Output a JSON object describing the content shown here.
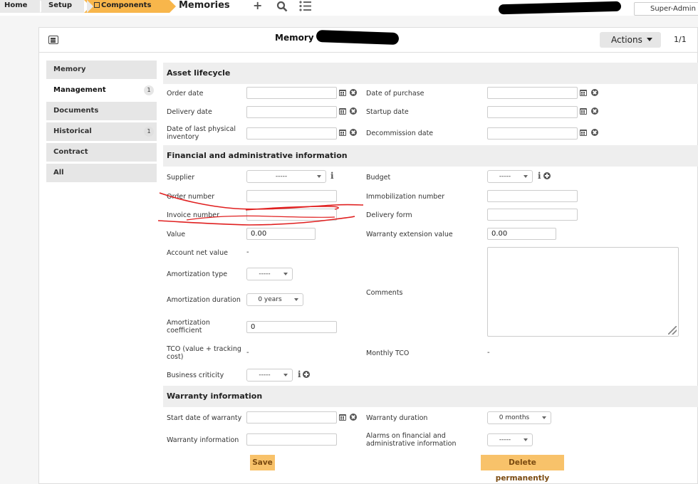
{
  "breadcrumbs": [
    "Home",
    "Setup",
    "Components"
  ],
  "page_heading": "Memories",
  "profile": "Super-Admin",
  "panel": {
    "title": "Memory",
    "actions_label": "Actions",
    "pager": "1/1"
  },
  "tabs": [
    {
      "label": "Memory",
      "count": ""
    },
    {
      "label": "Management",
      "count": "1"
    },
    {
      "label": "Documents",
      "count": ""
    },
    {
      "label": "Historical",
      "count": "1"
    },
    {
      "label": "Contract",
      "count": ""
    },
    {
      "label": "All",
      "count": ""
    }
  ],
  "sections": {
    "lifecycle": "Asset lifecycle",
    "financial": "Financial and administrative information",
    "warranty": "Warranty information"
  },
  "fields": {
    "order_date": "Order date",
    "date_of_purchase": "Date of purchase",
    "delivery_date": "Delivery date",
    "startup_date": "Startup date",
    "last_inventory": "Date of last physical inventory",
    "decommission_date": "Decommission date",
    "supplier": "Supplier",
    "budget": "Budget",
    "order_number": "Order number",
    "immobilization_number": "Immobilization number",
    "invoice_number": "Invoice number",
    "delivery_form": "Delivery form",
    "value": "Value",
    "warranty_ext_value": "Warranty extension value",
    "account_net_value": "Account net value",
    "amortization_type": "Amortization type",
    "amortization_duration": "Amortization duration",
    "comments": "Comments",
    "amortization_coefficient": "Amortization coefficient",
    "tco": "TCO (value + tracking cost)",
    "monthly_tco": "Monthly TCO",
    "business_criticity": "Business criticity",
    "start_warranty": "Start date of warranty",
    "warranty_duration": "Warranty duration",
    "warranty_info": "Warranty information",
    "alarms": "Alarms on financial and administrative information"
  },
  "values": {
    "supplier": "-----",
    "budget": "-----",
    "value": "0.00",
    "warranty_ext_value": "0.00",
    "account_net_value": "-",
    "amortization_type": "-----",
    "amortization_duration": "0 years",
    "amortization_coefficient": "0",
    "tco": "-",
    "monthly_tco": "-",
    "business_criticity": "-----",
    "warranty_duration": "0 months",
    "alarms": "-----"
  },
  "buttons": {
    "save": "Save",
    "delete": "Delete permanently"
  },
  "colors": {
    "accent": "#f8b64b",
    "button": "#f8c26a",
    "annotation": "#e02020"
  }
}
